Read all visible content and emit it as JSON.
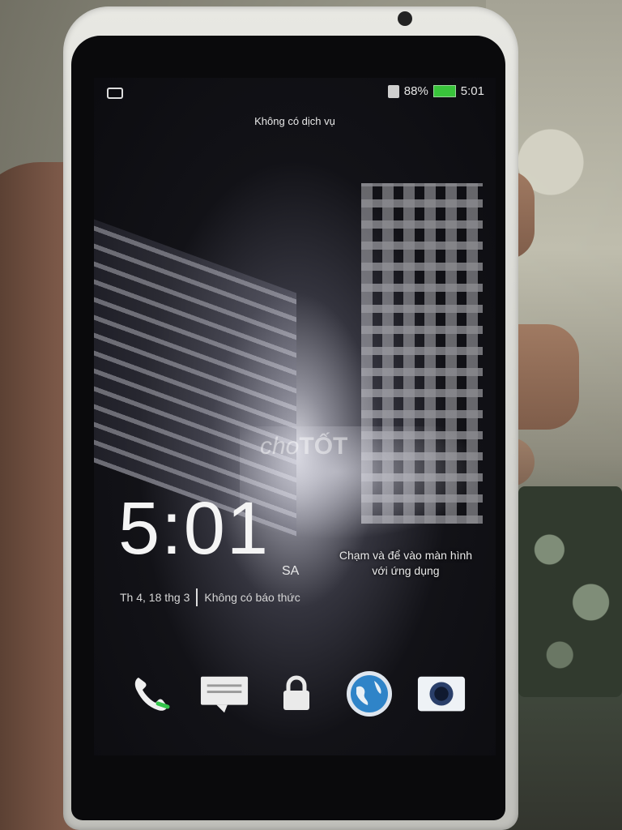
{
  "status_bar": {
    "battery_percent": "88%",
    "time": "5:01",
    "battery_color": "#39c43b"
  },
  "carrier_text": "Không có dịch vụ",
  "clock": {
    "time": "5:01",
    "ampm": "SA",
    "date": "Th 4, 18 thg 3",
    "alarm": "Không có báo thức"
  },
  "hint": {
    "line1": "Chạm và để vào màn hình",
    "line2": "với ứng dụng"
  },
  "dock": {
    "items": [
      "phone-icon",
      "messages-icon",
      "lock-icon",
      "browser-icon",
      "camera-icon"
    ]
  },
  "watermark": {
    "part1": "cho",
    "part2": "TỐT"
  }
}
